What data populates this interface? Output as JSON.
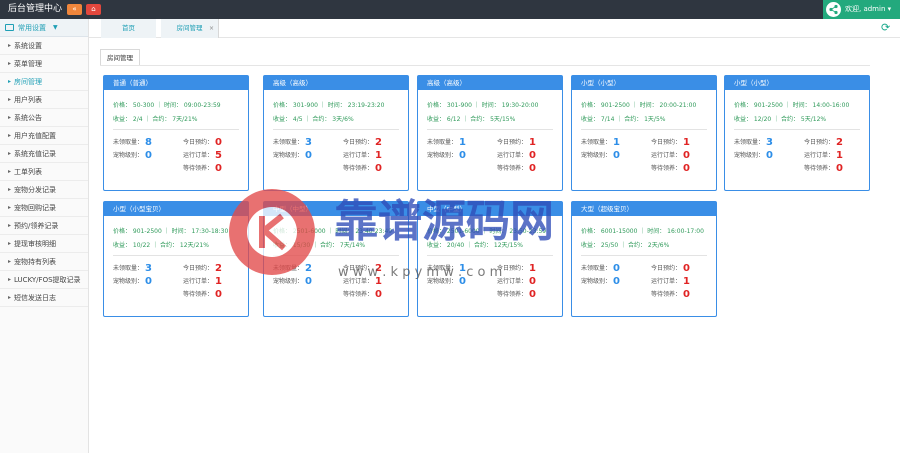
{
  "app_title": "后台管理中心",
  "top_buttons": {
    "back": "«",
    "home": "⌂"
  },
  "user": {
    "text": "欢迎, admin ▾"
  },
  "sidebar": {
    "header": "常用设置",
    "items": [
      {
        "label": "系统设置"
      },
      {
        "label": "菜单管理"
      },
      {
        "label": "房间管理"
      },
      {
        "label": "用户列表"
      },
      {
        "label": "系统公告"
      },
      {
        "label": "用户充值配置"
      },
      {
        "label": "系统充值记录"
      },
      {
        "label": "工单列表"
      },
      {
        "label": "宠物分发记录"
      },
      {
        "label": "宠物回购记录"
      },
      {
        "label": "预约/领养记录"
      },
      {
        "label": "提现审核明细"
      },
      {
        "label": "宠物持有列表"
      },
      {
        "label": "LUCKY/FOS提取记录"
      },
      {
        "label": "短信发送日志"
      }
    ]
  },
  "tabs": {
    "home": "首页",
    "current": "房间管理"
  },
  "sub_tab": "房间管理",
  "stat_labels": {
    "ready": "未领取量",
    "level": "宠物级别",
    "today": "今日预约",
    "running": "运行订单",
    "waiting": "等待领养"
  },
  "cards": [
    {
      "title": "普通（普通）",
      "r1": "价格： 50-300 ｜ 时间： 09:00-23:59",
      "r2": "收益： 2/4 ｜ 合约： 7天/21%",
      "ready": "8",
      "level": "0",
      "today": "0",
      "running": "5",
      "waiting": "0"
    },
    {
      "title": "高级（高级）",
      "r1": "价格： 301-900 ｜ 时间： 23:19-23:20",
      "r2": "收益： 4/5 ｜ 合约： 3天/6%",
      "ready": "3",
      "level": "0",
      "today": "2",
      "running": "1",
      "waiting": "0"
    },
    {
      "title": "高级（高级）",
      "r1": "价格： 301-900 ｜ 时间： 19:30-20:00",
      "r2": "收益： 6/12 ｜ 合约： 5天/15%",
      "ready": "1",
      "level": "0",
      "today": "1",
      "running": "0",
      "waiting": "0"
    },
    {
      "title": "小型（小型）",
      "r1": "价格： 901-2500 ｜ 时间： 20:00-21:00",
      "r2": "收益： 7/14 ｜ 合约： 1天/5%",
      "ready": "1",
      "level": "0",
      "today": "1",
      "running": "0",
      "waiting": "0"
    },
    {
      "title": "小型（小型）",
      "r1": "价格： 901-2500 ｜ 时间： 14:00-16:00",
      "r2": "收益： 12/20 ｜ 合约： 5天/12%",
      "ready": "3",
      "level": "0",
      "today": "2",
      "running": "1",
      "waiting": "0"
    },
    {
      "title": "小型（小型宝贝）",
      "r1": "价格： 901-2500 ｜ 时间： 17:30-18:30",
      "r2": "收益： 10/22 ｜ 合约： 12天/21%",
      "ready": "3",
      "level": "0",
      "today": "2",
      "running": "1",
      "waiting": "0"
    },
    {
      "title": "中型（中型）",
      "r1": "价格： 2501-6000 ｜ 时间： 23:40-23:49",
      "r2": "收益： 15/30 ｜ 合约： 7天/14%",
      "ready": "2",
      "level": "0",
      "today": "2",
      "running": "1",
      "waiting": "0"
    },
    {
      "title": "中型（中型）",
      "r1": "价格： 2501-6000 ｜ 时间： 23:50-23:59",
      "r2": "收益： 20/40 ｜ 合约： 12天/15%",
      "ready": "1",
      "level": "0",
      "today": "1",
      "running": "0",
      "waiting": "0"
    },
    {
      "title": "大型（超级宝贝）",
      "r1": "价格： 6001-15000 ｜ 时间： 16:00-17:00",
      "r2": "收益： 25/50 ｜ 合约： 2天/6%",
      "ready": "0",
      "level": "0",
      "today": "0",
      "running": "1",
      "waiting": "0"
    }
  ],
  "watermark": {
    "text": "靠谱源码网",
    "url": "w w w . k p y m w . c o m"
  },
  "colors": {
    "topbar": "#2f3640",
    "accent": "#1e9fb5",
    "card_blue": "#3a8ee6",
    "user_green": "#23a97d",
    "stat_red": "#e02424",
    "stat_blue": "#2d8ee8"
  }
}
